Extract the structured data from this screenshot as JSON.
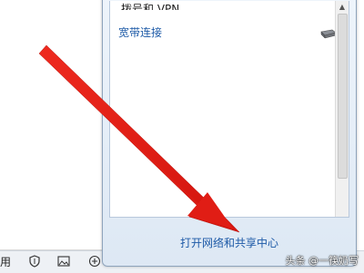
{
  "popup": {
    "section_header": "拨号和 VPN",
    "connections": [
      {
        "label": "宽带连接",
        "icon": "network-adapter-icon"
      }
    ],
    "footer_link": "打开网络和共享中心"
  },
  "taskbar": {
    "left_label": "用",
    "icons": [
      "shield-icon",
      "image-icon",
      "add-circle-icon"
    ]
  },
  "watermark": "头条 @一筷奶写",
  "annotation": {
    "color": "#e8201a",
    "shape": "arrow"
  }
}
